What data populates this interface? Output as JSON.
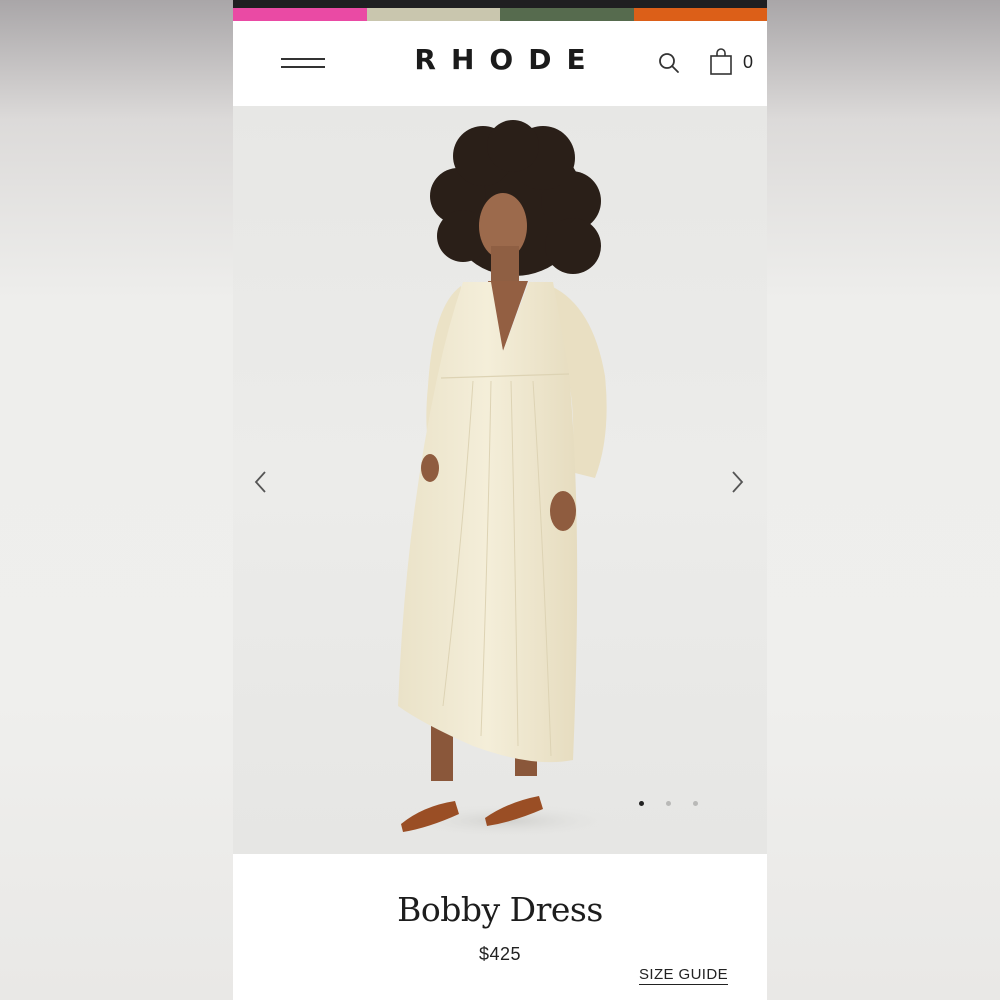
{
  "header": {
    "brand_colors": [
      "#ea4aa4",
      "#c9c6ae",
      "#566b4e",
      "#dc5f18"
    ],
    "logo": "RHODE",
    "cart_count": "0",
    "icons": [
      "menu-icon",
      "search-icon",
      "shopping-bag-icon"
    ]
  },
  "gallery": {
    "slide_count": 3,
    "active_slide": 1,
    "image_description_icon": "product-photo",
    "nav_icons": [
      "chevron-left-icon",
      "chevron-right-icon"
    ]
  },
  "product": {
    "title": "Bobby Dress",
    "price": "$425",
    "size_guide_label": "SIZE GUIDE"
  }
}
